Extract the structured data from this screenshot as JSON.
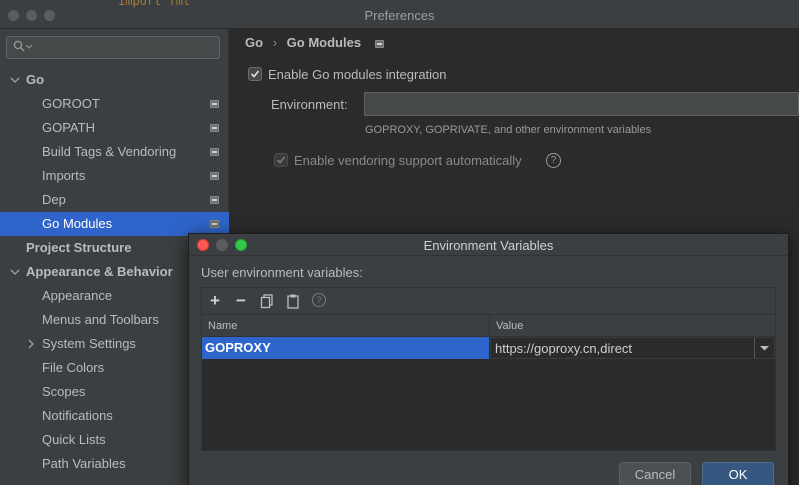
{
  "window": {
    "title": "Preferences",
    "code_snippet": "import  fmt"
  },
  "sidebar": {
    "search_placeholder": "",
    "items": [
      {
        "label": "Go",
        "bold": true,
        "expanded": true
      },
      {
        "label": "GOROOT"
      },
      {
        "label": "GOPATH"
      },
      {
        "label": "Build Tags & Vendoring"
      },
      {
        "label": "Imports"
      },
      {
        "label": "Dep"
      },
      {
        "label": "Go Modules",
        "selected": true
      },
      {
        "label": "Project Structure",
        "bold": true
      },
      {
        "label": "Appearance & Behavior",
        "bold": true,
        "expanded": true
      },
      {
        "label": "Appearance"
      },
      {
        "label": "Menus and Toolbars"
      },
      {
        "label": "System Settings",
        "collapsed": true
      },
      {
        "label": "File Colors"
      },
      {
        "label": "Scopes"
      },
      {
        "label": "Notifications"
      },
      {
        "label": "Quick Lists"
      },
      {
        "label": "Path Variables"
      }
    ]
  },
  "main": {
    "breadcrumb": [
      "Go",
      "Go Modules"
    ],
    "breadcrumb_sep": "›",
    "enable_modules_label": "Enable Go modules integration",
    "enable_modules_checked": true,
    "environment_label": "Environment:",
    "environment_value": "",
    "environment_hint": "GOPROXY, GOPRIVATE, and other environment variables",
    "vendoring_label": "Enable vendoring support automatically",
    "vendoring_checked": true,
    "vendoring_disabled": true,
    "help_glyph": "?"
  },
  "dialog": {
    "title": "Environment Variables",
    "user_vars_label": "User environment variables:",
    "toolbar": {
      "add": "+",
      "remove": "−",
      "help": "?"
    },
    "columns": {
      "name": "Name",
      "value": "Value"
    },
    "rows": [
      {
        "name": "GOPROXY",
        "value": "https://goproxy.cn,direct"
      }
    ],
    "cancel_label": "Cancel",
    "ok_label": "OK"
  },
  "colors": {
    "selection": "#2f65ca",
    "background": "#2b2b2b",
    "panel": "#3c3f41",
    "ok_button": "#365880"
  }
}
